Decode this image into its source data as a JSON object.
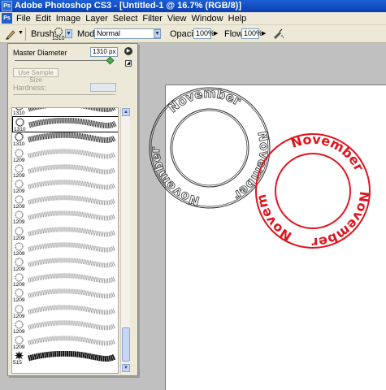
{
  "window": {
    "title": "Adobe Photoshop CS3 - [Untitled-1 @ 16.7% (RGB/8)]",
    "logo": "Ps"
  },
  "menubar": {
    "logo": "Ps",
    "items": [
      "File",
      "Edit",
      "Image",
      "Layer",
      "Select",
      "Filter",
      "View",
      "Window",
      "Help"
    ]
  },
  "options_bar": {
    "brush_label": "Brush:",
    "brush_size": "1310",
    "mode_label": "Mode:",
    "mode_value": "Normal",
    "opacity_label": "Opacity:",
    "opacity_value": "100%",
    "flow_label": "Flow:",
    "flow_value": "100%",
    "icons": [
      "brush-tool-icon",
      "brush-preset-icon",
      "airbrush-icon"
    ]
  },
  "brush_panel": {
    "master_diameter_label": "Master Diameter",
    "master_diameter_value": "1310 px",
    "master_diameter_fraction": 0.97,
    "use_sample_size_label": "Use Sample Size",
    "hardness_label": "Hardness:",
    "brushes": [
      {
        "size": "1310",
        "kind": "ring"
      },
      {
        "size": "1310",
        "kind": "ring",
        "selected": true
      },
      {
        "size": "1310",
        "kind": "ring"
      },
      {
        "size": "1209",
        "kind": "gear"
      },
      {
        "size": "1209",
        "kind": "gear"
      },
      {
        "size": "1209",
        "kind": "gear"
      },
      {
        "size": "1209",
        "kind": "gear"
      },
      {
        "size": "1209",
        "kind": "gear"
      },
      {
        "size": "1209",
        "kind": "gear"
      },
      {
        "size": "1209",
        "kind": "gear"
      },
      {
        "size": "1209",
        "kind": "gear"
      },
      {
        "size": "1209",
        "kind": "gear"
      },
      {
        "size": "1209",
        "kind": "gear"
      },
      {
        "size": "1209",
        "kind": "gear"
      },
      {
        "size": "1209",
        "kind": "gear"
      },
      {
        "size": "1209",
        "kind": "gear"
      },
      {
        "size": "515",
        "kind": "splat"
      }
    ]
  },
  "canvas": {
    "stamp_text": "November",
    "stamp_color_red": "#e0141e",
    "stamp_color_gray": "#2a2a2a"
  }
}
